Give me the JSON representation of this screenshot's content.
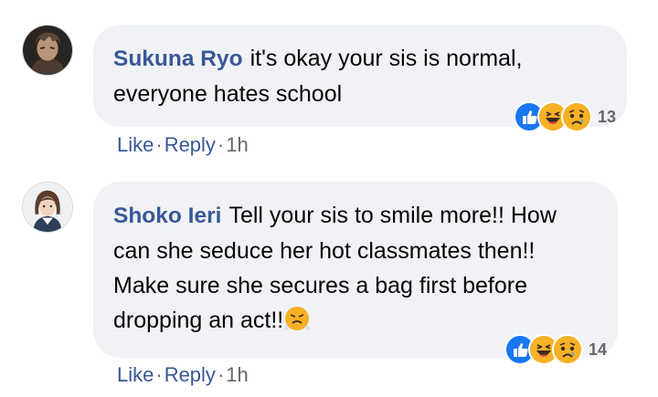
{
  "comments": [
    {
      "author": "Sukuna Ryo",
      "text": "it's okay your sis is normal, everyone hates school",
      "reaction_count": "13",
      "reactions": [
        "like-icon",
        "laugh-icon",
        "sad-icon"
      ],
      "actions": {
        "like": "Like",
        "reply": "Reply",
        "time": "1h"
      }
    },
    {
      "author": "Shoko Ieri",
      "text": "Tell your sis to smile more!! How can she seduce her hot classmates then!! Make sure she secures a bag first before dropping an act!!",
      "reaction_count": "14",
      "reactions": [
        "like-icon",
        "laugh-icon",
        "sad-icon"
      ],
      "actions": {
        "like": "Like",
        "reply": "Reply",
        "time": "1h"
      }
    }
  ],
  "colors": {
    "link": "#385898",
    "bubble": "#f0f2f5",
    "like": "#1877f2",
    "emoji": "#f7b125"
  }
}
